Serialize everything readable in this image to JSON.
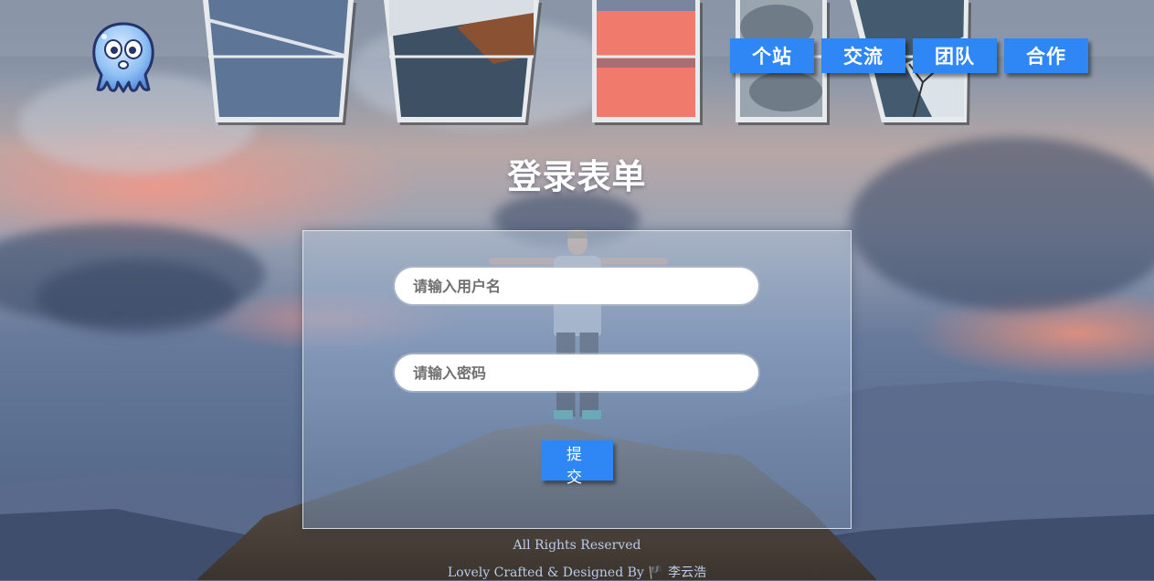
{
  "nav": {
    "items": [
      {
        "label": "个站"
      },
      {
        "label": "交流"
      },
      {
        "label": "团队"
      },
      {
        "label": "合作"
      }
    ]
  },
  "form": {
    "title": "登录表单",
    "username_placeholder": "请输入用户名",
    "password_placeholder": "请输入密码",
    "submit_label": "提 交"
  },
  "footer": {
    "rights": "All Rights Reserved",
    "credit": "Lovely Crafted & Designed By 🏴 李云浩"
  },
  "colors": {
    "accent": "#2f86f5",
    "title": "#ffffff",
    "footer_text": "#b9cbe6"
  },
  "icons": {
    "logo": "octopus-icon"
  }
}
